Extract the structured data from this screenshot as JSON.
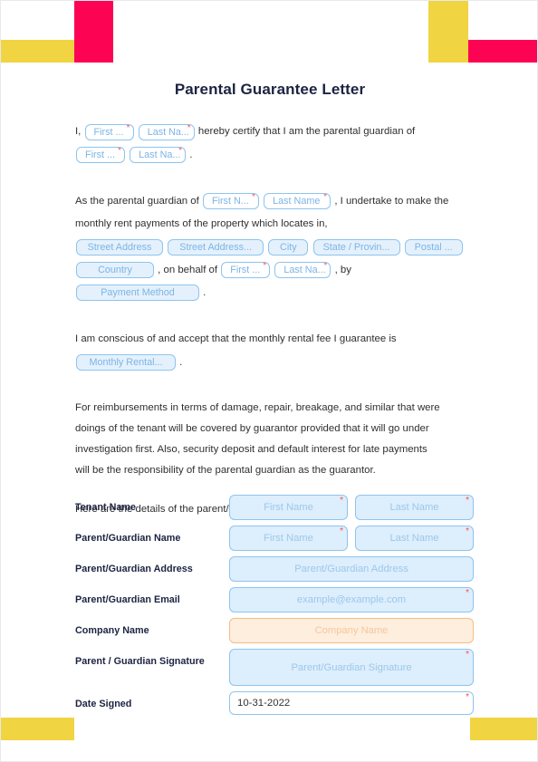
{
  "document": {
    "title": "Parental Guarantee Letter"
  },
  "decorations": {
    "yellow": "#f0d441",
    "pink": "#fc0354"
  },
  "paragraph1": {
    "lead": "I,",
    "chip_first": "First ...",
    "chip_last": "Last Na...",
    "mid": "hereby certify that I am the parental guardian of",
    "chip_first2": "First ...",
    "chip_last2": "Last Na...",
    "end": "."
  },
  "paragraph2": {
    "t1": "As the parental guardian of",
    "chip_first": "First N...",
    "chip_last": "Last Name",
    "t2": ", I undertake to make the",
    "t3": "monthly rent payments of the property which locates in,",
    "chip_street1": "Street Address",
    "chip_street2": "Street Address...",
    "chip_city": "City",
    "chip_state": "State / Provin...",
    "chip_postal": "Postal ...",
    "chip_country": "Country",
    "t4": ", on behalf of",
    "chip_first2": "First ...",
    "chip_last2": "Last Na...",
    "t5": ", by",
    "chip_payment": "Payment Method",
    "end": "."
  },
  "paragraph3": {
    "t1": "I am conscious of and accept that the monthly rental fee I guarantee is",
    "chip_rental": "Monthly Rental...",
    "end": "."
  },
  "paragraph4": {
    "line1": "For reimbursements in terms of damage, repair, breakage, and similar that were",
    "line2": "doings of the tenant will be covered by guarantor provided that it will go under",
    "line3": "investigation first. Also, security deposit and default interest for late payments",
    "line4": "will be the responsibility of the parental guardian as the guarantor."
  },
  "paragraph5": {
    "line1": "Here are the details of the parent/guarantor:"
  },
  "details": {
    "rows": [
      {
        "label": "Tenant Name",
        "fields": [
          {
            "placeholder": "First Name",
            "required": true
          },
          {
            "placeholder": "Last Name",
            "required": true
          }
        ]
      },
      {
        "label": "Parent/Guardian Name",
        "fields": [
          {
            "placeholder": "First Name",
            "required": true
          },
          {
            "placeholder": "Last Name",
            "required": true
          }
        ]
      },
      {
        "label": "Parent/Guardian Address",
        "fields": [
          {
            "placeholder": "Parent/Guardian Address",
            "required": false
          }
        ]
      },
      {
        "label": "Parent/Guardian Email",
        "fields": [
          {
            "placeholder": "example@example.com",
            "required": true
          }
        ]
      },
      {
        "label": "Company Name",
        "fields": [
          {
            "placeholder": "Company Name",
            "required": false
          }
        ]
      },
      {
        "label": "Parent / Guardian Signature",
        "fields": [
          {
            "placeholder": "Parent/Guardian Signature",
            "required": true
          }
        ]
      },
      {
        "label": "Date Signed",
        "fields": [
          {
            "value": "10-31-2022",
            "required": true
          }
        ]
      }
    ]
  },
  "colors": {
    "field_fill": "#ddeefc",
    "field_border": "#8ec4ee",
    "field_text": "#9cc8ea",
    "orange_fill": "#fdeede",
    "orange_border": "#f4bd86",
    "orange_text": "#f7c79b",
    "required_star": "#ff4b4b",
    "title": "#1c2342"
  }
}
